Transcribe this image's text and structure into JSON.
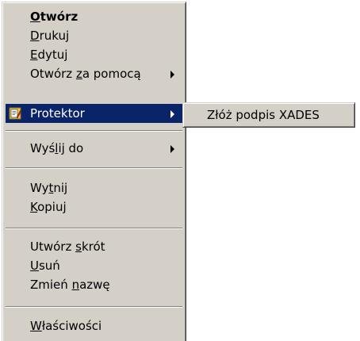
{
  "context_menu": {
    "items": [
      {
        "pre": "",
        "acc": "O",
        "post": "twórz",
        "bold": true,
        "submenu": false
      },
      {
        "pre": "",
        "acc": "D",
        "post": "rukuj",
        "bold": false,
        "submenu": false
      },
      {
        "pre": "",
        "acc": "E",
        "post": "dytuj",
        "bold": false,
        "submenu": false
      },
      {
        "pre": "Otwórz ",
        "acc": "z",
        "post": "a pomocą",
        "bold": false,
        "submenu": true
      },
      {
        "pre": "Protektor",
        "acc": "",
        "post": "",
        "bold": false,
        "submenu": true,
        "highlighted": true,
        "icon": "protektor-app-icon"
      },
      {
        "pre": "Wyś",
        "acc": "l",
        "post": "ij do",
        "bold": false,
        "submenu": true
      },
      {
        "pre": "Wy",
        "acc": "t",
        "post": "nij",
        "bold": false,
        "submenu": false
      },
      {
        "pre": "",
        "acc": "K",
        "post": "opiuj",
        "bold": false,
        "submenu": false
      },
      {
        "pre": "Utwórz ",
        "acc": "s",
        "post": "krót",
        "bold": false,
        "submenu": false
      },
      {
        "pre": "",
        "acc": "U",
        "post": "suń",
        "bold": false,
        "submenu": false
      },
      {
        "pre": "Zmień ",
        "acc": "n",
        "post": "azwę",
        "bold": false,
        "submenu": false
      },
      {
        "pre": "",
        "acc": "W",
        "post": "łaściwości",
        "bold": false,
        "submenu": false
      }
    ]
  },
  "protektor_submenu": {
    "items": [
      {
        "label": "Złóż podpis XADES"
      }
    ]
  },
  "colors": {
    "menu_face": "#d4d0c8",
    "highlight": "#0a246a",
    "highlight_text": "#ffffff"
  }
}
